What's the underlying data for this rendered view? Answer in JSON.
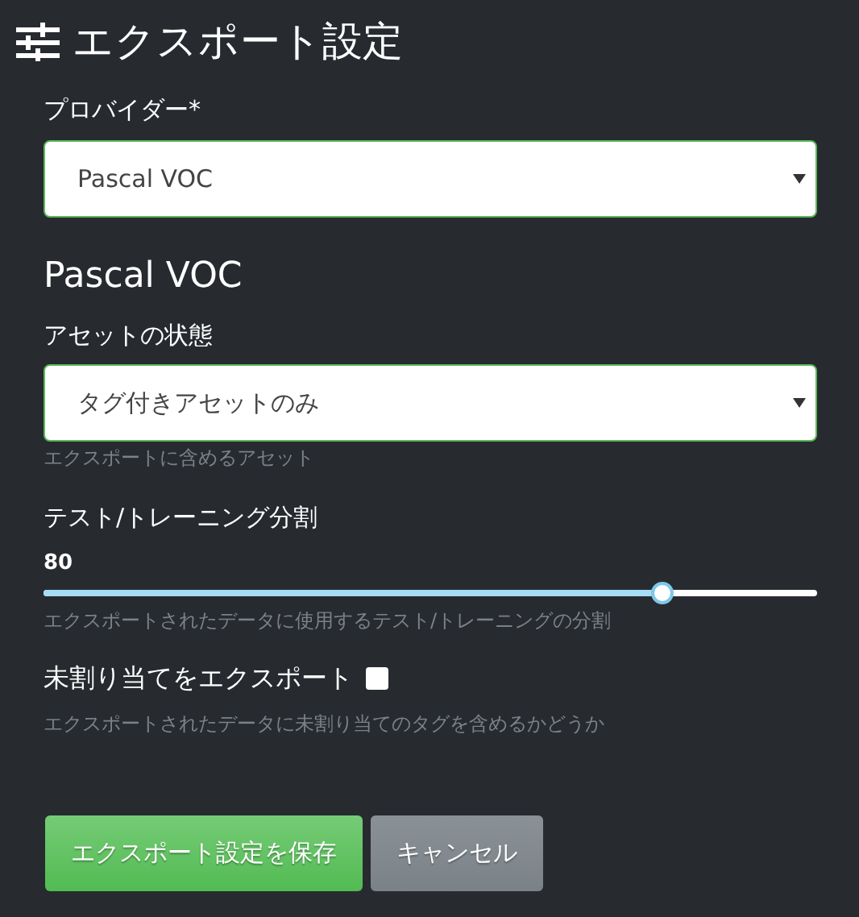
{
  "header": {
    "title": "エクスポート設定"
  },
  "provider": {
    "label": "プロバイダー*",
    "value": "Pascal VOC"
  },
  "section_title": "Pascal VOC",
  "asset_state": {
    "label": "アセットの状態",
    "value": "タグ付きアセットのみ",
    "help": "エクスポートに含めるアセット"
  },
  "split": {
    "label": "テスト/トレーニング分割",
    "reading": "80",
    "level": 0.8,
    "help": "エクスポートされたデータに使用するテスト/トレーニングの分割"
  },
  "include_unassigned": {
    "label": "未割り当てをエクスポート",
    "checked": false,
    "help": "エクスポートされたデータに未割り当てのタグを含めるかどうか"
  },
  "buttons": [
    {
      "label": "エクスポート設定を保存",
      "kind": "primary"
    },
    {
      "label": "キャンセル",
      "kind": "secondary"
    }
  ]
}
